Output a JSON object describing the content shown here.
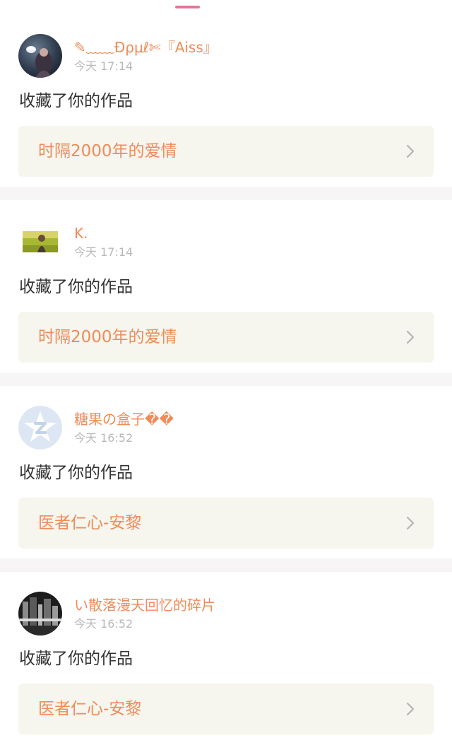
{
  "colors": {
    "accent": "#ee8c59",
    "tab_indicator": "#e4759c",
    "work_box_bg": "#f6f5ee",
    "separator": "#f7f5f5",
    "time_text": "#b9b9b9"
  },
  "notifications": [
    {
      "username": "✎﹏﹏Ðρμℓ✄『Aiss』",
      "time": "今天 17:14",
      "action": "收藏了你的作品",
      "work_title": "时隔2000年的爱情",
      "avatar_icon": "avatar-night-portrait"
    },
    {
      "username": "K.",
      "time": "今天 17:14",
      "action": "收藏了你的作品",
      "work_title": "时隔2000年的爱情",
      "avatar_icon": "avatar-field-photo"
    },
    {
      "username": "糖果の盒子��",
      "time": "今天 16:52",
      "action": "收藏了你的作品",
      "work_title": "医者仁心-安黎",
      "avatar_icon": "avatar-default-qzone"
    },
    {
      "username": "い散落漫天回忆的碎片",
      "time": "今天 16:52",
      "action": "收藏了你的作品",
      "work_title": "医者仁心-安黎",
      "avatar_icon": "avatar-city-bw"
    }
  ]
}
